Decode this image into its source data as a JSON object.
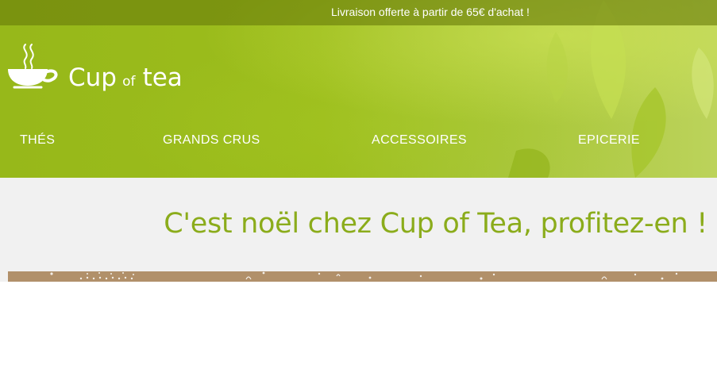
{
  "topbar": {
    "message": "Livraison offerte à partir de 65€ d'achat !"
  },
  "logo": {
    "word1": "Cup",
    "word2": "of",
    "word3": "tea",
    "icon": "teacup-icon"
  },
  "nav": {
    "items": [
      {
        "label": "THÉS"
      },
      {
        "label": "GRANDS CRUS"
      },
      {
        "label": "ACCESSOIRES"
      },
      {
        "label": "EPICERIE"
      }
    ]
  },
  "banner": {
    "title": "C'est noël chez Cup of Tea, profitez-en !"
  },
  "colors": {
    "brand_green": "#97b81a",
    "title_green": "#8bac1b",
    "banner_bg": "#f1f1f1",
    "strip_brown": "#b1906a"
  }
}
